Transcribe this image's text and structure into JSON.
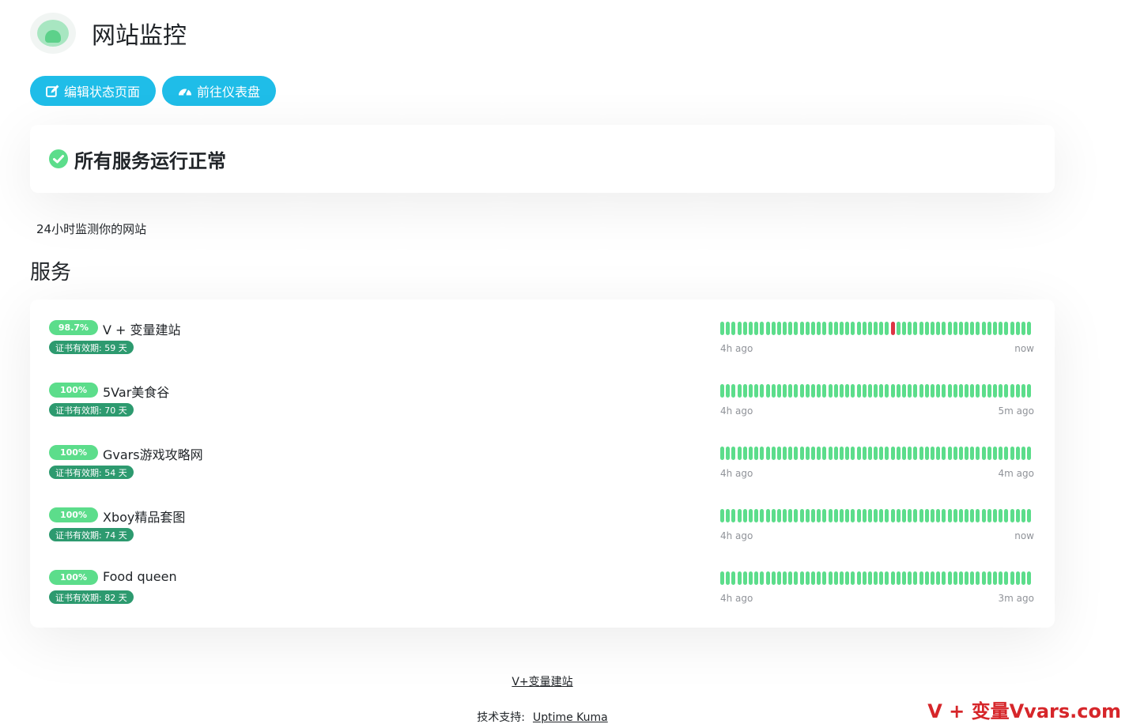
{
  "header": {
    "title": "网站监控",
    "logo_icon": "uptime-kuma-logo"
  },
  "buttons": {
    "edit_label": "编辑状态页面",
    "dashboard_label": "前往仪表盘"
  },
  "status": {
    "text": "所有服务运行正常",
    "icon": "check-circle-icon",
    "color": "#5cdd8b"
  },
  "description": "24小时监测你的网站",
  "section_title": "服务",
  "services": [
    {
      "uptime": "98.7%",
      "name": "V + 变量建站",
      "cert": "证书有效期: 59 天",
      "time_start": "4h ago",
      "time_end": "now",
      "down_beats": [
        30
      ]
    },
    {
      "uptime": "100%",
      "name": "5Var美食谷",
      "cert": "证书有效期: 70 天",
      "time_start": "4h ago",
      "time_end": "5m ago",
      "down_beats": []
    },
    {
      "uptime": "100%",
      "name": "Gvars游戏攻略网",
      "cert": "证书有效期: 54 天",
      "time_start": "4h ago",
      "time_end": "4m ago",
      "down_beats": []
    },
    {
      "uptime": "100%",
      "name": "Xboy精品套图",
      "cert": "证书有效期: 74 天",
      "time_start": "4h ago",
      "time_end": "now",
      "down_beats": []
    },
    {
      "uptime": "100%",
      "name": "Food queen",
      "cert": "证书有效期: 82 天",
      "time_start": "4h ago",
      "time_end": "3m ago",
      "down_beats": []
    }
  ],
  "beats_per_row": 55,
  "colors": {
    "accent": "#1fbde8",
    "up": "#5cdd8b",
    "down": "#dc3545",
    "cert": "#2d9a6f"
  },
  "footer": {
    "site_link": "V+变量建站",
    "credit_label": "技术支持:",
    "credit_link": "Uptime Kuma"
  },
  "watermark": "V + 变量Vvars.com"
}
